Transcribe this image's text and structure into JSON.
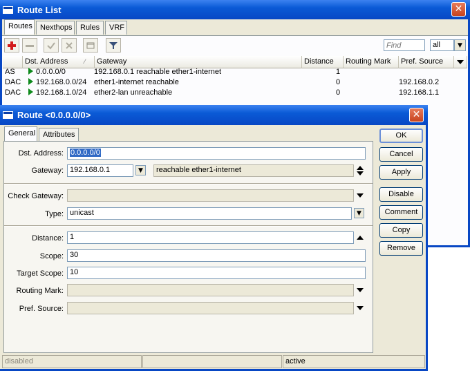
{
  "route_list": {
    "title": "Route List",
    "close": "✕",
    "tabs": [
      "Routes",
      "Nexthops",
      "Rules",
      "VRF"
    ],
    "find_placeholder": "Find",
    "filter_value": "all",
    "columns": [
      "",
      "Dst. Address",
      "Gateway",
      "Distance",
      "Routing Mark",
      "Pref. Source"
    ],
    "rows": [
      {
        "flags": "AS",
        "dst": "0.0.0.0/0",
        "gateway": "192.168.0.1 reachable ether1-internet",
        "distance": "1",
        "mark": "",
        "pref": ""
      },
      {
        "flags": "DAC",
        "dst": "192.168.0.0/24",
        "gateway": "ether1-internet reachable",
        "distance": "0",
        "mark": "",
        "pref": "192.168.0.2"
      },
      {
        "flags": "DAC",
        "dst": "192.168.1.0/24",
        "gateway": "ether2-lan unreachable",
        "distance": "0",
        "mark": "",
        "pref": "192.168.1.1"
      }
    ]
  },
  "route_dialog": {
    "title": "Route <0.0.0.0/0>",
    "close": "✕",
    "tabs": [
      "General",
      "Attributes"
    ],
    "fields": {
      "dst_address": {
        "label": "Dst. Address:",
        "value": "0.0.0.0/0"
      },
      "gateway": {
        "label": "Gateway:",
        "value": "192.168.0.1",
        "status": "reachable ether1-internet"
      },
      "check_gateway": {
        "label": "Check Gateway:",
        "value": ""
      },
      "type": {
        "label": "Type:",
        "value": "unicast"
      },
      "distance": {
        "label": "Distance:",
        "value": "1"
      },
      "scope": {
        "label": "Scope:",
        "value": "30"
      },
      "target_scope": {
        "label": "Target Scope:",
        "value": "10"
      },
      "routing_mark": {
        "label": "Routing Mark:",
        "value": ""
      },
      "pref_source": {
        "label": "Pref. Source:",
        "value": ""
      }
    },
    "buttons": [
      "OK",
      "Cancel",
      "Apply",
      "Disable",
      "Comment",
      "Copy",
      "Remove"
    ],
    "status": [
      "disabled",
      "",
      "active"
    ]
  },
  "icons": [
    "add-icon",
    "remove-icon",
    "enable-icon",
    "disable-icon",
    "comment-icon",
    "filter-icon"
  ],
  "colors": {
    "titlebar": "#0a5ad6",
    "close": "#c8431e",
    "flag": "#0e8a1c",
    "selection": "#316ac5"
  }
}
